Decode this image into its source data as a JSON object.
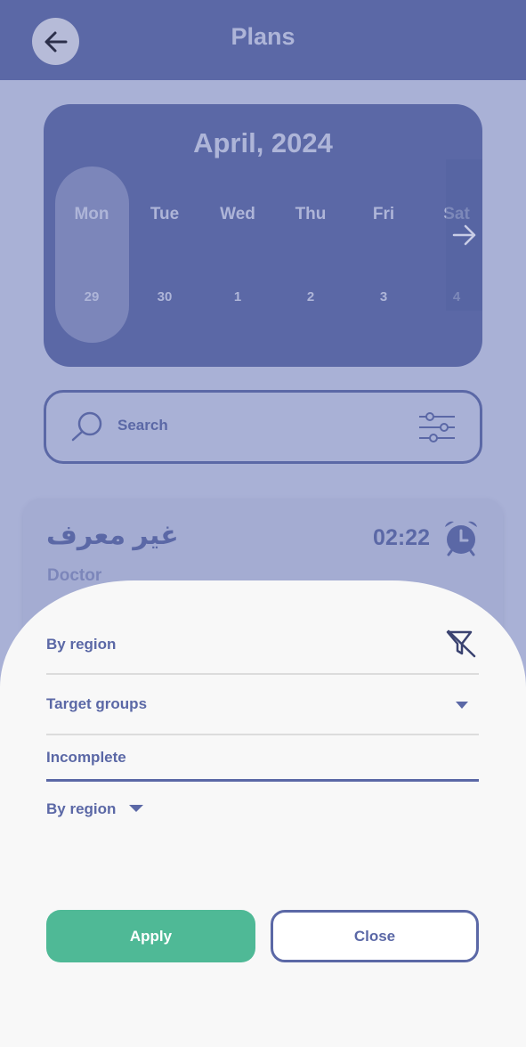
{
  "header": {
    "title": "Plans",
    "back_icon": "arrow-left-icon"
  },
  "calendar": {
    "month": "April, 2024",
    "days": [
      {
        "name": "Mon",
        "num": "29",
        "selected": true
      },
      {
        "name": "Tue",
        "num": "30"
      },
      {
        "name": "Wed",
        "num": "1"
      },
      {
        "name": "Thu",
        "num": "2"
      },
      {
        "name": "Fri",
        "num": "3"
      },
      {
        "name": "Sat",
        "num": "4"
      }
    ],
    "next_icon": "arrow-right-icon"
  },
  "search": {
    "placeholder": "Search",
    "search_icon": "search-icon",
    "filter_icon": "sliders-icon"
  },
  "plan": {
    "name": "غير معرف",
    "role": "Doctor",
    "time": "02:22",
    "icon": "alarm-clock-icon"
  },
  "filter_sheet": {
    "rows": [
      {
        "label": "By region",
        "icon": "filter-off-icon"
      },
      {
        "label": "Target groups",
        "icon": "dropdown-icon"
      },
      {
        "label": "Incomplete"
      },
      {
        "label": "By region",
        "icon": "dropdown-icon"
      }
    ],
    "apply_label": "Apply",
    "close_label": "Close"
  },
  "colors": {
    "primary": "#5b68a6",
    "accent_green": "#4fb996",
    "overlay": "#a9b1d6",
    "sheet_bg": "#f8f8f8"
  }
}
